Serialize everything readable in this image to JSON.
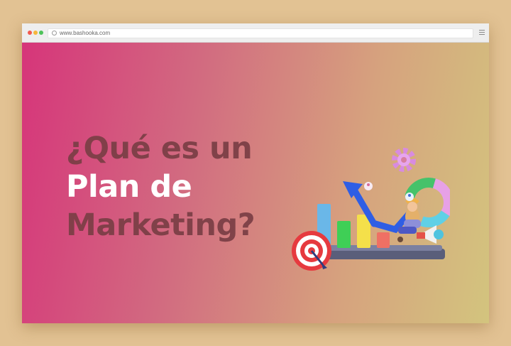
{
  "browser": {
    "url": "www.bashooka.com",
    "window_controls": [
      "close",
      "minimize",
      "maximize"
    ],
    "menu_icon": "hamburger-menu-icon"
  },
  "hero": {
    "headline_line1": "¿Qué es un",
    "headline_line2": "Plan de",
    "headline_line3": "Marketing?",
    "colors": {
      "gradient_start": "#d6357a",
      "gradient_end": "#d3c47e",
      "muted_text": "#7a3e45",
      "highlight_text": "#ffffff"
    }
  },
  "illustration": {
    "icons": [
      "gear-icon",
      "target-icon",
      "megaphone-icon",
      "donut-chart-icon",
      "bar-chart-icon",
      "growth-arrow-icon"
    ]
  }
}
